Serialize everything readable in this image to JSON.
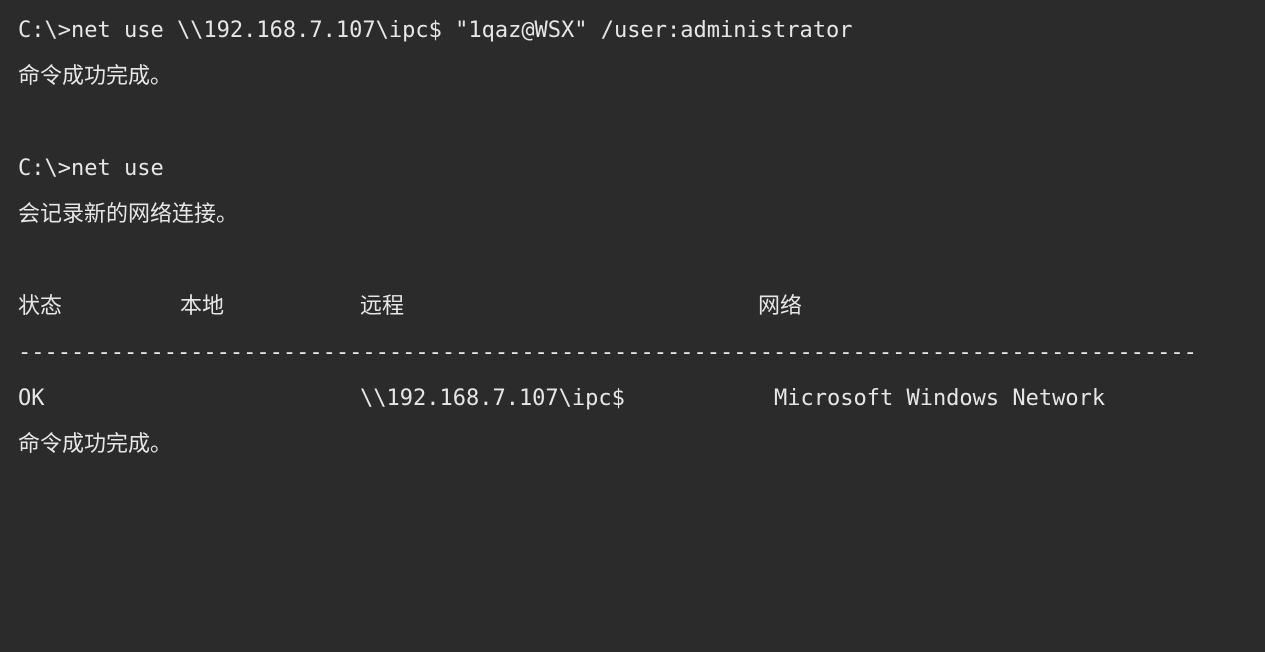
{
  "terminal": {
    "cmd1": "C:\\>net use \\\\192.168.7.107\\ipc$ \"1qaz@WSX\" /user:administrator",
    "result1": "命令成功完成。",
    "cmd2": "C:\\>net use",
    "result2": "会记录新的网络连接。",
    "table": {
      "headers": {
        "status": "状态",
        "local": "本地",
        "remote": "远程",
        "network": "网络"
      },
      "separator": "-----------------------------------------------------------------------------------------",
      "rows": [
        {
          "status": "OK",
          "local": "",
          "remote": "\\\\192.168.7.107\\ipc$",
          "network": "Microsoft Windows Network"
        }
      ]
    },
    "result3": "命令成功完成。"
  },
  "colors": {
    "background": "#2b2b2b",
    "text": "#e6e6e6"
  }
}
